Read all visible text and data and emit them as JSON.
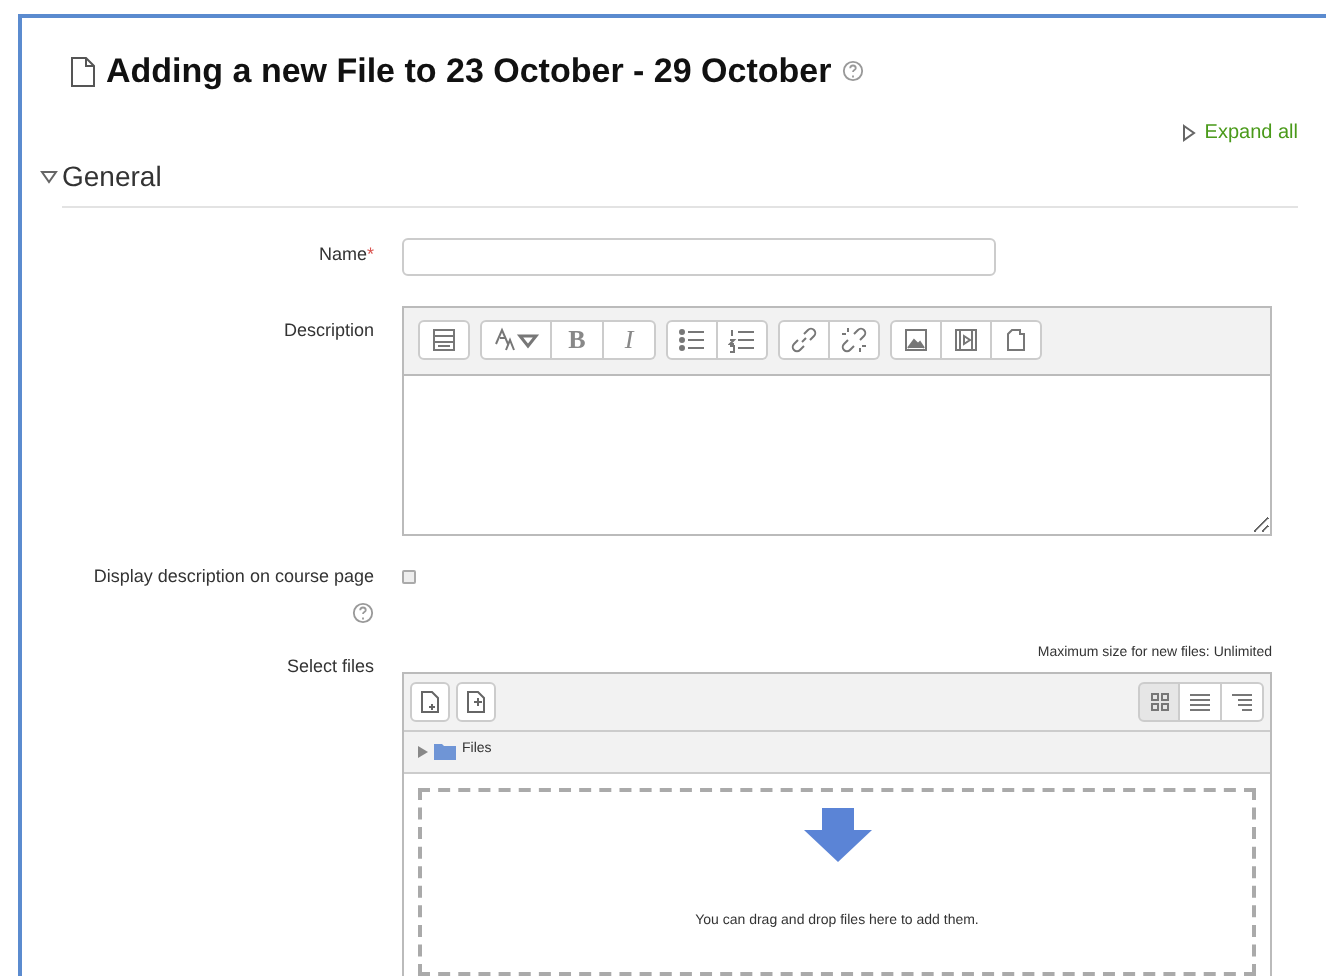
{
  "page": {
    "title": "Adding a new File to 23 October - 29 October",
    "expand_all": "Expand all"
  },
  "section": {
    "title": "General",
    "expanded": true
  },
  "name_field": {
    "label": "Name",
    "required_mark": "*"
  },
  "description": {
    "label": "Description",
    "toolbar": [
      [
        {
          "kind": "icon"
        }
      ],
      [
        {
          "kind": "icon"
        },
        {
          "kind": "text",
          "text": "B"
        },
        {
          "kind": "text",
          "text": "I"
        }
      ],
      [
        {
          "kind": "icon"
        },
        {
          "kind": "icon"
        }
      ],
      [
        {
          "kind": "icon"
        },
        {
          "kind": "icon"
        }
      ],
      [
        {
          "kind": "icon"
        },
        {
          "kind": "icon"
        },
        {
          "kind": "icon"
        }
      ]
    ]
  },
  "display_description": {
    "label": "Display description on course page",
    "checked": false
  },
  "select_files": {
    "label": "Select files",
    "max_size": "Maximum size for new files: Unlimited",
    "folder": "Files",
    "drop_hint": "You can drag and drop files here to add them."
  }
}
